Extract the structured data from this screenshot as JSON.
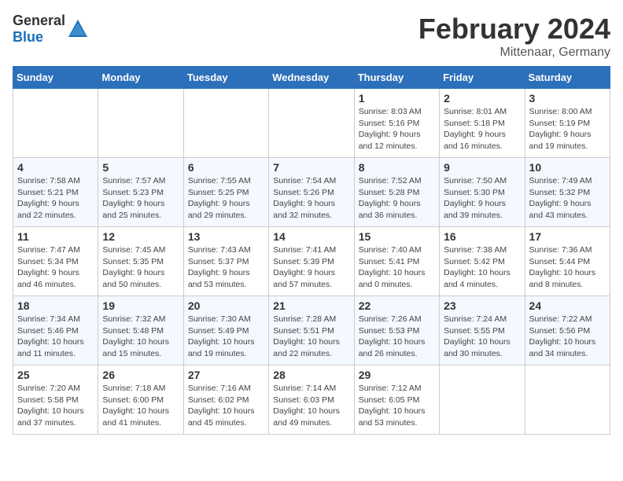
{
  "header": {
    "logo_general": "General",
    "logo_blue": "Blue",
    "month": "February 2024",
    "location": "Mittenaar, Germany"
  },
  "days_of_week": [
    "Sunday",
    "Monday",
    "Tuesday",
    "Wednesday",
    "Thursday",
    "Friday",
    "Saturday"
  ],
  "weeks": [
    [
      {
        "day": "",
        "info": ""
      },
      {
        "day": "",
        "info": ""
      },
      {
        "day": "",
        "info": ""
      },
      {
        "day": "",
        "info": ""
      },
      {
        "day": "1",
        "info": "Sunrise: 8:03 AM\nSunset: 5:16 PM\nDaylight: 9 hours\nand 12 minutes."
      },
      {
        "day": "2",
        "info": "Sunrise: 8:01 AM\nSunset: 5:18 PM\nDaylight: 9 hours\nand 16 minutes."
      },
      {
        "day": "3",
        "info": "Sunrise: 8:00 AM\nSunset: 5:19 PM\nDaylight: 9 hours\nand 19 minutes."
      }
    ],
    [
      {
        "day": "4",
        "info": "Sunrise: 7:58 AM\nSunset: 5:21 PM\nDaylight: 9 hours\nand 22 minutes."
      },
      {
        "day": "5",
        "info": "Sunrise: 7:57 AM\nSunset: 5:23 PM\nDaylight: 9 hours\nand 25 minutes."
      },
      {
        "day": "6",
        "info": "Sunrise: 7:55 AM\nSunset: 5:25 PM\nDaylight: 9 hours\nand 29 minutes."
      },
      {
        "day": "7",
        "info": "Sunrise: 7:54 AM\nSunset: 5:26 PM\nDaylight: 9 hours\nand 32 minutes."
      },
      {
        "day": "8",
        "info": "Sunrise: 7:52 AM\nSunset: 5:28 PM\nDaylight: 9 hours\nand 36 minutes."
      },
      {
        "day": "9",
        "info": "Sunrise: 7:50 AM\nSunset: 5:30 PM\nDaylight: 9 hours\nand 39 minutes."
      },
      {
        "day": "10",
        "info": "Sunrise: 7:49 AM\nSunset: 5:32 PM\nDaylight: 9 hours\nand 43 minutes."
      }
    ],
    [
      {
        "day": "11",
        "info": "Sunrise: 7:47 AM\nSunset: 5:34 PM\nDaylight: 9 hours\nand 46 minutes."
      },
      {
        "day": "12",
        "info": "Sunrise: 7:45 AM\nSunset: 5:35 PM\nDaylight: 9 hours\nand 50 minutes."
      },
      {
        "day": "13",
        "info": "Sunrise: 7:43 AM\nSunset: 5:37 PM\nDaylight: 9 hours\nand 53 minutes."
      },
      {
        "day": "14",
        "info": "Sunrise: 7:41 AM\nSunset: 5:39 PM\nDaylight: 9 hours\nand 57 minutes."
      },
      {
        "day": "15",
        "info": "Sunrise: 7:40 AM\nSunset: 5:41 PM\nDaylight: 10 hours\nand 0 minutes."
      },
      {
        "day": "16",
        "info": "Sunrise: 7:38 AM\nSunset: 5:42 PM\nDaylight: 10 hours\nand 4 minutes."
      },
      {
        "day": "17",
        "info": "Sunrise: 7:36 AM\nSunset: 5:44 PM\nDaylight: 10 hours\nand 8 minutes."
      }
    ],
    [
      {
        "day": "18",
        "info": "Sunrise: 7:34 AM\nSunset: 5:46 PM\nDaylight: 10 hours\nand 11 minutes."
      },
      {
        "day": "19",
        "info": "Sunrise: 7:32 AM\nSunset: 5:48 PM\nDaylight: 10 hours\nand 15 minutes."
      },
      {
        "day": "20",
        "info": "Sunrise: 7:30 AM\nSunset: 5:49 PM\nDaylight: 10 hours\nand 19 minutes."
      },
      {
        "day": "21",
        "info": "Sunrise: 7:28 AM\nSunset: 5:51 PM\nDaylight: 10 hours\nand 22 minutes."
      },
      {
        "day": "22",
        "info": "Sunrise: 7:26 AM\nSunset: 5:53 PM\nDaylight: 10 hours\nand 26 minutes."
      },
      {
        "day": "23",
        "info": "Sunrise: 7:24 AM\nSunset: 5:55 PM\nDaylight: 10 hours\nand 30 minutes."
      },
      {
        "day": "24",
        "info": "Sunrise: 7:22 AM\nSunset: 5:56 PM\nDaylight: 10 hours\nand 34 minutes."
      }
    ],
    [
      {
        "day": "25",
        "info": "Sunrise: 7:20 AM\nSunset: 5:58 PM\nDaylight: 10 hours\nand 37 minutes."
      },
      {
        "day": "26",
        "info": "Sunrise: 7:18 AM\nSunset: 6:00 PM\nDaylight: 10 hours\nand 41 minutes."
      },
      {
        "day": "27",
        "info": "Sunrise: 7:16 AM\nSunset: 6:02 PM\nDaylight: 10 hours\nand 45 minutes."
      },
      {
        "day": "28",
        "info": "Sunrise: 7:14 AM\nSunset: 6:03 PM\nDaylight: 10 hours\nand 49 minutes."
      },
      {
        "day": "29",
        "info": "Sunrise: 7:12 AM\nSunset: 6:05 PM\nDaylight: 10 hours\nand 53 minutes."
      },
      {
        "day": "",
        "info": ""
      },
      {
        "day": "",
        "info": ""
      }
    ]
  ]
}
